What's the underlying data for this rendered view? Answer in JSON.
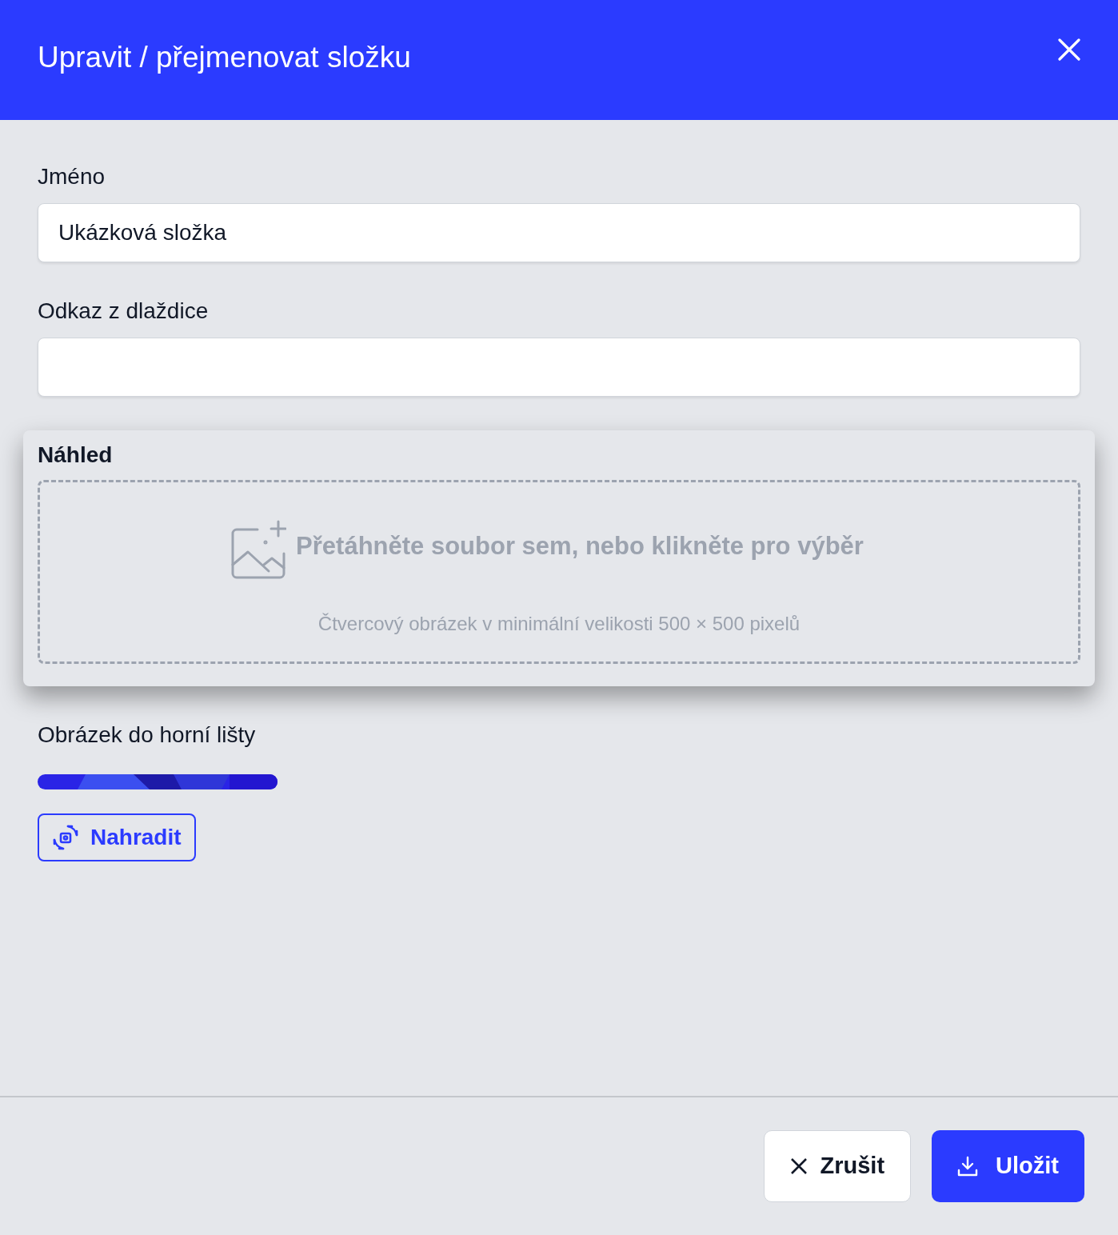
{
  "dialog": {
    "title": "Upravit / přejmenovat složku"
  },
  "fields": [
    {
      "label": "Jméno",
      "value": "Ukázková složka"
    },
    {
      "label": "Odkaz z dlaždice"
    }
  ],
  "preview": {
    "label": "Náhled",
    "dropzone": {
      "title": "Přetáhněte soubor sem, nebo klikněte pro výběr",
      "hint": "Čtvercový obrázek v minimální velikosti 500 × 500 pixelů"
    }
  },
  "header_image": {
    "label": "Obrázek do horní lišty",
    "replace_button": "Nahradit"
  },
  "footer": {
    "buttons": [
      {
        "kind": "cancel",
        "label": "Zrušit"
      },
      {
        "kind": "save",
        "label": "Uložit"
      }
    ]
  }
}
